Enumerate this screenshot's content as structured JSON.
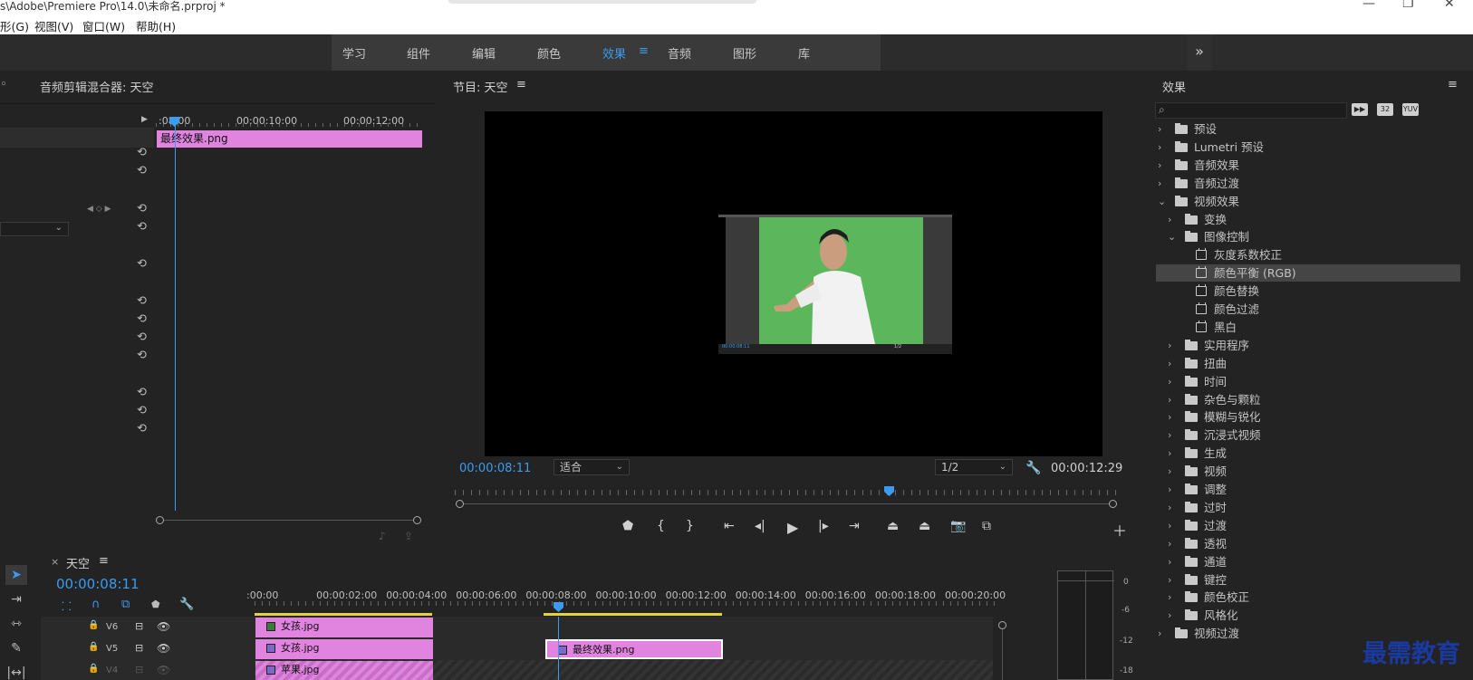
{
  "titlebar": {
    "title": "s\\Adobe\\Premiere Pro\\14.0\\未命名.prproj *",
    "minimize": "—",
    "restore": "❐",
    "close": "✕"
  },
  "menubar": {
    "items": [
      "形(G)",
      "视图(V)",
      "窗口(W)",
      "帮助(H)"
    ]
  },
  "workspace": {
    "tabs": [
      "学习",
      "组件",
      "编辑",
      "颜色",
      "效果",
      "音频",
      "图形",
      "库"
    ],
    "active": "效果",
    "menu_glyph": "≡",
    "more": "»"
  },
  "mixer": {
    "title": "音频剪辑混合器: 天空",
    "ruler": [
      ":08:00",
      "00:00:10:00",
      "00:00:12:00"
    ],
    "clip_name": "最终效果.png",
    "reset_glyph": "⟲"
  },
  "program": {
    "title": "节目: 天空",
    "menu_glyph": "≡",
    "timecode_current": "00:00:08:11",
    "timecode_duration": "00:00:12:29",
    "fit_select": "适合",
    "resolution_select": "1/2",
    "inner_timecode": "00:00:08:11",
    "inner_res": "1/2"
  },
  "effects": {
    "title": "效果",
    "menu_glyph": "≡",
    "badges": [
      "32",
      "YUV"
    ],
    "tree": [
      {
        "label": "预设",
        "level": 0,
        "type": "folder-special",
        "expanded": false
      },
      {
        "label": "Lumetri 预设",
        "level": 0,
        "type": "folder-special",
        "expanded": false
      },
      {
        "label": "音频效果",
        "level": 0,
        "type": "folder",
        "expanded": false
      },
      {
        "label": "音频过渡",
        "level": 0,
        "type": "folder",
        "expanded": false
      },
      {
        "label": "视频效果",
        "level": 0,
        "type": "folder",
        "expanded": true
      },
      {
        "label": "变换",
        "level": 1,
        "type": "folder",
        "expanded": false
      },
      {
        "label": "图像控制",
        "level": 1,
        "type": "folder",
        "expanded": true
      },
      {
        "label": "灰度系数校正",
        "level": 2,
        "type": "fx"
      },
      {
        "label": "颜色平衡 (RGB)",
        "level": 2,
        "type": "fx",
        "selected": true
      },
      {
        "label": "颜色替换",
        "level": 2,
        "type": "fx"
      },
      {
        "label": "颜色过滤",
        "level": 2,
        "type": "fx"
      },
      {
        "label": "黑白",
        "level": 2,
        "type": "fx"
      },
      {
        "label": "实用程序",
        "level": 1,
        "type": "folder",
        "expanded": false
      },
      {
        "label": "扭曲",
        "level": 1,
        "type": "folder",
        "expanded": false
      },
      {
        "label": "时间",
        "level": 1,
        "type": "folder",
        "expanded": false
      },
      {
        "label": "杂色与颗粒",
        "level": 1,
        "type": "folder",
        "expanded": false
      },
      {
        "label": "模糊与锐化",
        "level": 1,
        "type": "folder",
        "expanded": false
      },
      {
        "label": "沉浸式视频",
        "level": 1,
        "type": "folder",
        "expanded": false
      },
      {
        "label": "生成",
        "level": 1,
        "type": "folder",
        "expanded": false
      },
      {
        "label": "视频",
        "level": 1,
        "type": "folder",
        "expanded": false
      },
      {
        "label": "调整",
        "level": 1,
        "type": "folder",
        "expanded": false
      },
      {
        "label": "过时",
        "level": 1,
        "type": "folder",
        "expanded": false
      },
      {
        "label": "过渡",
        "level": 1,
        "type": "folder",
        "expanded": false
      },
      {
        "label": "透视",
        "level": 1,
        "type": "folder",
        "expanded": false
      },
      {
        "label": "通道",
        "level": 1,
        "type": "folder",
        "expanded": false
      },
      {
        "label": "键控",
        "level": 1,
        "type": "folder",
        "expanded": false
      },
      {
        "label": "颜色校正",
        "level": 1,
        "type": "folder",
        "expanded": false
      },
      {
        "label": "风格化",
        "level": 1,
        "type": "folder",
        "expanded": false
      },
      {
        "label": "视频过渡",
        "level": 0,
        "type": "folder",
        "expanded": false
      }
    ]
  },
  "timeline": {
    "sequence_name": "天空",
    "close_glyph": "×",
    "menu_glyph": "≡",
    "timecode": "00:00:08:11",
    "ruler": [
      ":00:00",
      "00:00:02:00",
      "00:00:04:00",
      "00:00:06:00",
      "00:00:08:00",
      "00:00:10:00",
      "00:00:12:00",
      "00:00:14:00",
      "00:00:16:00",
      "00:00:18:00",
      "00:00:20:00"
    ],
    "tracks": [
      {
        "name": "V6",
        "clips": [
          {
            "label": "女孩.jpg"
          }
        ]
      },
      {
        "name": "V5",
        "clips": [
          {
            "label": "女孩.jpg"
          },
          {
            "label": "最终效果.png"
          }
        ]
      },
      {
        "name": "V4",
        "clips": [
          {
            "label": "苹果.jpg"
          }
        ]
      }
    ]
  },
  "meter": {
    "scale": [
      "0",
      "-6",
      "-12",
      "-18"
    ]
  },
  "watermark": "最需教育",
  "colors": {
    "accent": "#3c9bf0",
    "clip_pink": "#e084e0",
    "green_screen": "#5cb65c"
  }
}
